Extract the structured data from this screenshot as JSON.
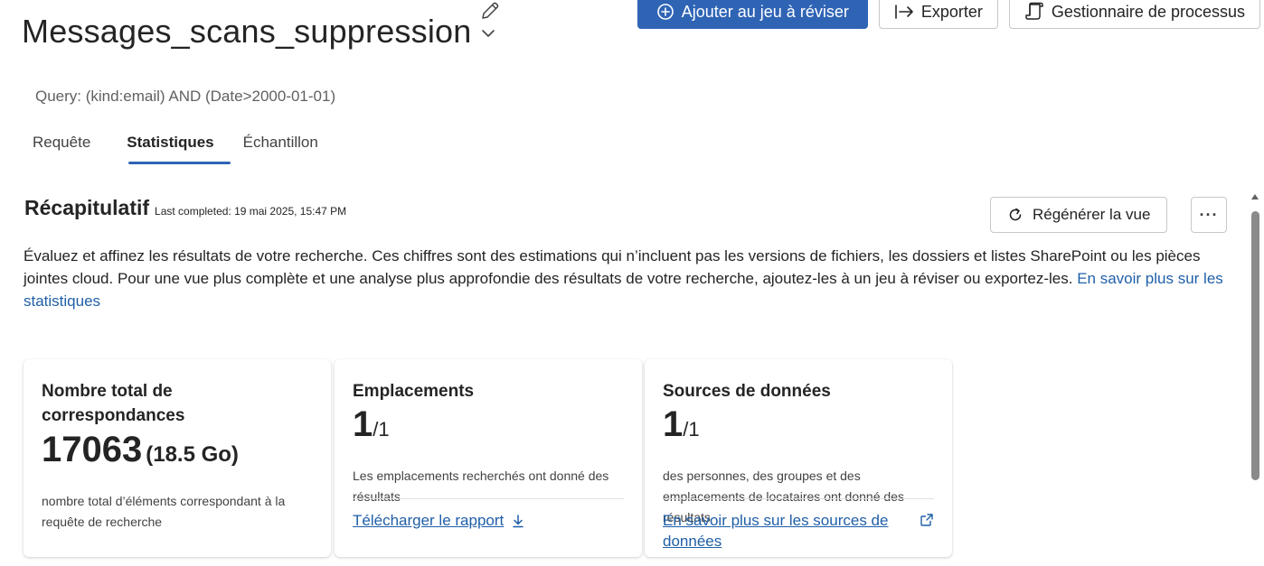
{
  "header": {
    "title": "Messages_scans_suppression",
    "actions": {
      "add_review": "Ajouter au jeu à réviser",
      "export": "Exporter",
      "process_manager": "Gestionnaire de processus"
    },
    "query": "Query: (kind:email) AND (Date>2000-01-01)"
  },
  "tabs": [
    {
      "label": "Requête",
      "active": false
    },
    {
      "label": "Statistiques",
      "active": true
    },
    {
      "label": "Échantillon",
      "active": false
    }
  ],
  "summary": {
    "title": "Récapitulatif",
    "last_completed": "Last completed: 19 mai 2025, 15:47 PM",
    "regen_label": "Régénérer la vue",
    "more_label": "···",
    "description": "Évaluez et affinez les résultats de votre recherche. Ces chiffres sont des estimations qui n’incluent pas les versions de fichiers, les dossiers et listes SharePoint ou les pièces jointes cloud. Pour une vue plus complète et une analyse plus approfondie des résultats de votre recherche, ajoutez-les à un jeu à réviser ou exportez-les.",
    "learn_more": "En savoir plus sur les statistiques"
  },
  "cards": {
    "total": {
      "title": "Nombre total de correspondances",
      "value": "17063",
      "size": "(18.5 Go)",
      "description": "nombre total d’éléments correspondant à la requête de recherche"
    },
    "locations": {
      "title": "Emplacements",
      "value": "1",
      "total": "/1",
      "description": "Les emplacements recherchés ont donné des résultats",
      "link": "Télécharger le rapport"
    },
    "sources": {
      "title": "Sources de données",
      "value": "1",
      "total": "/1",
      "description": "des personnes, des groupes et des emplacements de locataires ont donné des résultats",
      "link": "En savoir plus sur les sources de données"
    }
  },
  "colors": {
    "primary": "#2f64b5",
    "link": "#1f5fa8"
  },
  "icons": {
    "chevron": "chevron-down-icon",
    "edit": "pencil-icon",
    "add": "plus-circle-icon",
    "export": "export-arrow-icon",
    "process": "document-gear-icon",
    "refresh": "refresh-icon",
    "download": "download-icon",
    "external": "external-link-icon"
  }
}
